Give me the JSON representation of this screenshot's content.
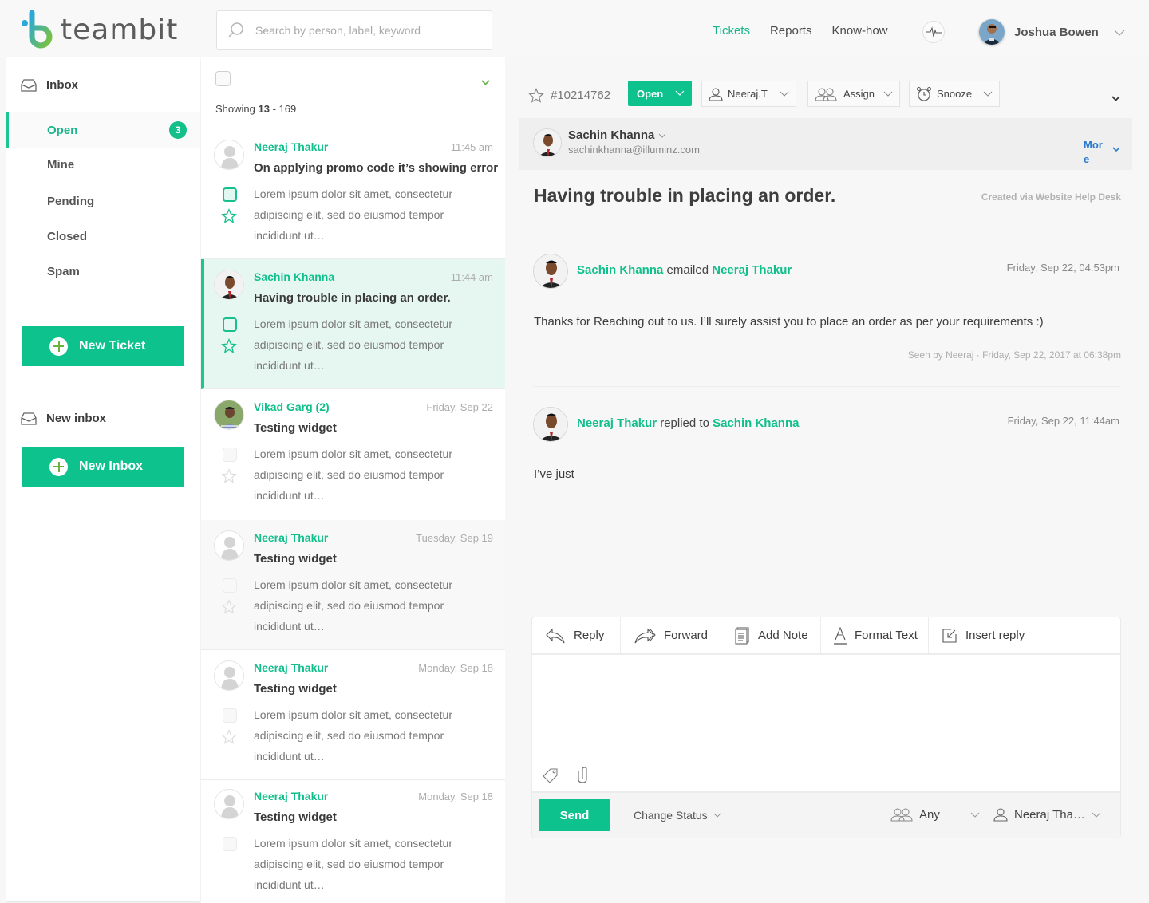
{
  "header": {
    "brand": "teambit",
    "search_placeholder": "Search by person, label, keyword",
    "nav": [
      {
        "label": "Tickets",
        "active": true
      },
      {
        "label": "Reports",
        "active": false
      },
      {
        "label": "Know-how",
        "active": false
      }
    ],
    "user_name": "Joshua Bowen"
  },
  "sidebar": {
    "inbox_label": "Inbox",
    "items": [
      {
        "label": "Open",
        "badge": "3",
        "active": true
      },
      {
        "label": "Mine"
      },
      {
        "label": "Pending"
      },
      {
        "label": "Closed"
      },
      {
        "label": "Spam"
      }
    ],
    "new_ticket_label": "New Ticket",
    "new_inbox_heading": "New inbox",
    "new_inbox_label": "New Inbox"
  },
  "list": {
    "showing_prefix": "Showing ",
    "showing_current": "13",
    "showing_suffix": " - 169",
    "tickets": [
      {
        "name": "Neeraj Thakur",
        "time": "11:45 am",
        "subject": "On applying promo code it’s showing error",
        "preview": "Lorem ipsum dolor sit amet, consectetur adipiscing elit, sed do eiusmod tempor incididunt ut…"
      },
      {
        "name": "Sachin Khanna",
        "time": "11:44 am",
        "subject": "Having trouble in placing an order.",
        "preview": "Lorem ipsum dolor sit amet, consectetur adipiscing elit, sed do eiusmod tempor incididunt ut…"
      },
      {
        "name": "Vikad Garg (2)",
        "time": "Friday, Sep 22",
        "subject": "Testing widget",
        "preview": "Lorem ipsum dolor sit amet, consectetur adipiscing elit, sed do eiusmod tempor incididunt ut…"
      },
      {
        "name": "Neeraj Thakur",
        "time": "Tuesday, Sep 19",
        "subject": "Testing widget",
        "preview": "Lorem ipsum dolor sit amet, consectetur adipiscing elit, sed do eiusmod tempor incididunt ut…"
      },
      {
        "name": "Neeraj Thakur",
        "time": "Monday, Sep 18",
        "subject": "Testing widget",
        "preview": "Lorem ipsum dolor sit amet, consectetur adipiscing elit, sed do eiusmod tempor incididunt ut…"
      },
      {
        "name": "Neeraj Thakur",
        "time": "Monday, Sep 18",
        "subject": "Testing widget",
        "preview": "Lorem ipsum dolor sit amet, consectetur adipiscing elit, sed do eiusmod tempor incididunt ut…"
      }
    ]
  },
  "detail": {
    "ticket_id": "#10214762",
    "status": "Open",
    "agent": "Neeraj.T",
    "assign_label": "Assign",
    "snooze_label": "Snooze",
    "contact": {
      "name": "Sachin Khanna",
      "email": "sachinkhanna@illuminz.com",
      "more_label": "More"
    },
    "subject": "Having trouble in placing an order.",
    "created_via": "Created via Website Help Desk",
    "messages": [
      {
        "from": "Sachin Khanna",
        "verb": " emailed ",
        "to": "Neeraj Thakur",
        "time": "Friday, Sep 22, 04:53pm",
        "body": "Thanks for Reaching out to us. I’ll surely assist you to place an order as per your requirements :)",
        "seen": "Seen by Neeraj  ·  Friday, Sep 22, 2017 at 06:38pm"
      },
      {
        "from": "Neeraj Thakur",
        "verb": " replied to ",
        "to": "Sachin Khanna",
        "time": "Friday, Sep 22, 11:44am",
        "body": "I’ve just"
      }
    ]
  },
  "composer": {
    "tabs": [
      {
        "label": "Reply",
        "icon": "reply-icon"
      },
      {
        "label": "Forward",
        "icon": "forward-icon"
      },
      {
        "label": "Add Note",
        "icon": "note-icon"
      },
      {
        "label": "Format Text",
        "icon": "format-text-icon"
      },
      {
        "label": "Insert reply",
        "icon": "insert-reply-icon"
      }
    ],
    "send_label": "Send",
    "change_status_label": "Change Status",
    "team_label": "Any",
    "assignee_label": "Neeraj Tha…"
  },
  "colors": {
    "accent": "#0dc28d",
    "link_blue": "#2a7bd0",
    "selected_row_bg": "#e6f7f2"
  }
}
